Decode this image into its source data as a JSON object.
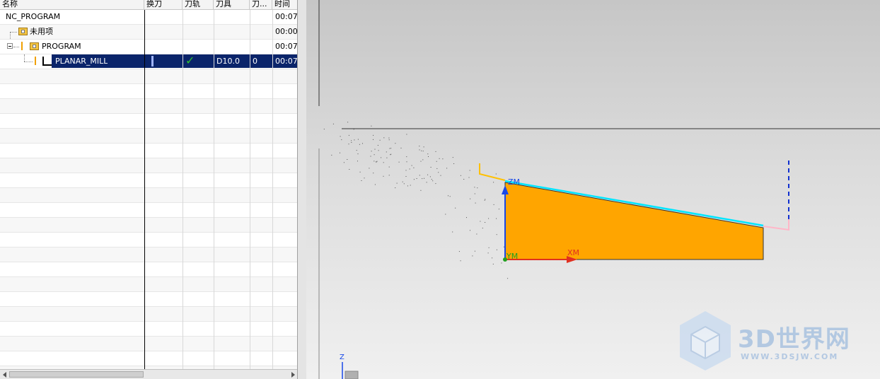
{
  "navigator": {
    "columns": [
      "名称",
      "换刀",
      "刀轨",
      "刀具",
      "刀...",
      "时间"
    ],
    "rows": [
      {
        "name": "NC_PROGRAM",
        "time": "00:07"
      },
      {
        "name": "未用项",
        "time": "00:00"
      },
      {
        "name": "PROGRAM",
        "time": "00:07"
      },
      {
        "name": "PLANAR_MILL",
        "toolpath": "✓",
        "tool": "D10.0",
        "tool_num": "0",
        "time": "00:07",
        "selected": true
      }
    ]
  },
  "viewport": {
    "axis_labels": {
      "zm": "ZM",
      "xm": "XM",
      "ym": "YM",
      "z": "Z"
    },
    "part_color": "#ffa500",
    "toolpath_color": "#00e5ff",
    "watermark": {
      "brand": "3D世界网",
      "url": "WWW.3DSJW.COM"
    }
  }
}
